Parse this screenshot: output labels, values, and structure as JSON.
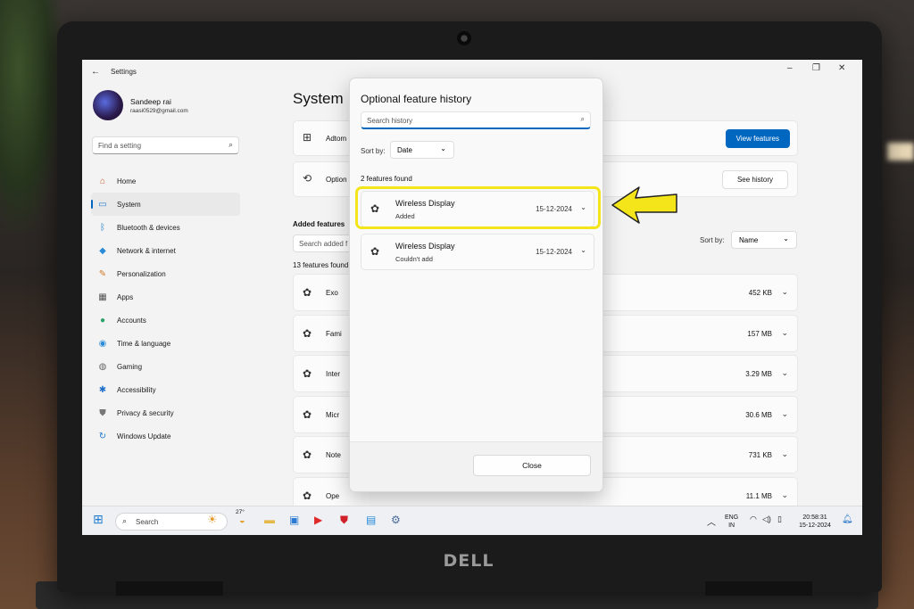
{
  "window": {
    "app_title": "Settings",
    "back_glyph": "←",
    "controls": {
      "minimize": "–",
      "maximize": "❐",
      "close": "✕"
    }
  },
  "profile": {
    "name": "Sandeep rai",
    "email": "raasi0529@gmail.com"
  },
  "sidebar": {
    "search_placeholder": "Find a setting",
    "items": [
      {
        "label": "Home",
        "icon": "home-icon",
        "glyph": "⌂",
        "color": "#c75a2a"
      },
      {
        "label": "System",
        "icon": "system-icon",
        "glyph": "▭",
        "color": "#1f7bd1",
        "active": true
      },
      {
        "label": "Bluetooth & devices",
        "icon": "bluetooth-icon",
        "glyph": "ᛒ",
        "color": "#1f7bd1"
      },
      {
        "label": "Network & internet",
        "icon": "wifi-icon",
        "glyph": "◆",
        "color": "#2a8bd8"
      },
      {
        "label": "Personalization",
        "icon": "brush-icon",
        "glyph": "✎",
        "color": "#d07a2a"
      },
      {
        "label": "Apps",
        "icon": "apps-icon",
        "glyph": "▦",
        "color": "#555555"
      },
      {
        "label": "Accounts",
        "icon": "accounts-icon",
        "glyph": "●",
        "color": "#2aa36b"
      },
      {
        "label": "Time & language",
        "icon": "globe-icon",
        "glyph": "◉",
        "color": "#2a8bd8"
      },
      {
        "label": "Gaming",
        "icon": "gamepad-icon",
        "glyph": "◍",
        "color": "#666666"
      },
      {
        "label": "Accessibility",
        "icon": "accessibility-icon",
        "glyph": "✱",
        "color": "#1f6fc8"
      },
      {
        "label": "Privacy & security",
        "icon": "shield-icon",
        "glyph": "⛊",
        "color": "#777777"
      },
      {
        "label": "Windows Update",
        "icon": "update-icon",
        "glyph": "↻",
        "color": "#1f7bd1"
      }
    ]
  },
  "main": {
    "title": "System",
    "card1": {
      "label": "Adtom",
      "icon": "add-feature-icon",
      "button": "View features"
    },
    "card2": {
      "label": "Option",
      "icon": "history-icon",
      "button": "See history"
    },
    "added_features_label": "Added features",
    "search_placeholder": "Search added f",
    "count": "13 features found",
    "sort_label": "Sort by:",
    "sort_value": "Name",
    "features": [
      {
        "name": "Exo",
        "size": "452 KB"
      },
      {
        "name": "Fami",
        "size": "157 MB"
      },
      {
        "name": "Inter",
        "size": "3.29 MB"
      },
      {
        "name": "Micr",
        "size": "30.6 MB"
      },
      {
        "name": "Note",
        "size": "731 KB"
      },
      {
        "name": "Ope",
        "size": "11.1 MB"
      }
    ]
  },
  "dialog": {
    "title": "Optional feature history",
    "search_placeholder": "Search history",
    "sort_label": "Sort by:",
    "sort_value": "Date",
    "count": "2 features found",
    "items": [
      {
        "name": "Wireless Display",
        "status": "Added",
        "date": "15-12-2024"
      },
      {
        "name": "Wireless Display",
        "status": "Couldn't add",
        "date": "15-12-2024"
      }
    ],
    "close_label": "Close"
  },
  "taskbar": {
    "search_placeholder": "Search",
    "weather_temp": "27°",
    "language_line1": "ENG",
    "language_line2": "IN",
    "time": "20:58:31",
    "date": "15-12-2024"
  },
  "brand": "DELL",
  "colors": {
    "accent": "#0067c0",
    "highlight": "#f4e51a"
  }
}
